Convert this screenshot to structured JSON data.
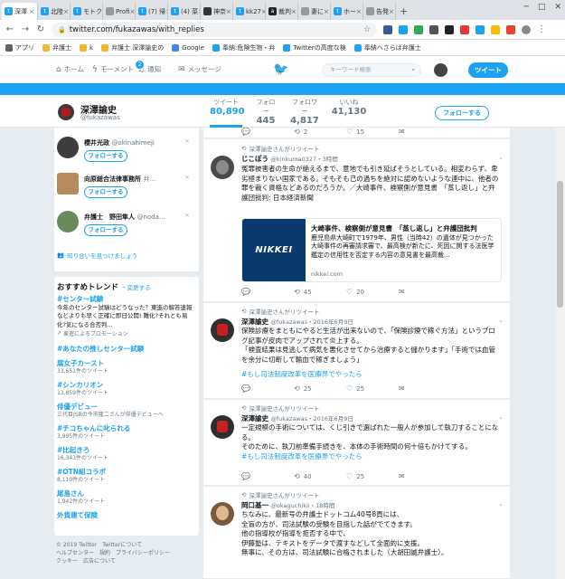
{
  "browser": {
    "tabs": [
      {
        "label": "深澤",
        "icon": "twitter-icon",
        "active": true
      },
      {
        "label": "北陸",
        "icon": "twitter-icon"
      },
      {
        "label": "モトク",
        "icon": "twitter-icon"
      },
      {
        "label": "Profi",
        "icon": "page-icon"
      },
      {
        "label": "(7) 帰",
        "icon": "twitter-icon"
      },
      {
        "label": "(4) 菜",
        "icon": "twitter-icon"
      },
      {
        "label": "神奈",
        "icon": "site-icon"
      },
      {
        "label": "kk27",
        "icon": "twitter-icon"
      },
      {
        "label": "裁判",
        "icon": "amazon-icon"
      },
      {
        "label": "妻に",
        "icon": "page-icon"
      },
      {
        "label": "ホー",
        "icon": "twitter-icon"
      },
      {
        "label": "告発",
        "icon": "page-icon"
      }
    ],
    "url": "twitter.com/fukazawas/with_replies",
    "bookmarks": [
      {
        "label": "アプリ",
        "icon": "apps-icon"
      },
      {
        "label": "弁護士",
        "icon": "folder-icon"
      },
      {
        "label": "k",
        "icon": "folder-icon"
      },
      {
        "label": "弁護士 深澤諭史の",
        "icon": "folder-icon"
      },
      {
        "label": "Google",
        "icon": "google-icon"
      },
      {
        "label": "奉納:危険生物・弁",
        "icon": "twitter-icon"
      },
      {
        "label": "Twitterの高度な検",
        "icon": "twitter-icon"
      },
      {
        "label": "奉納へさらば弁護士",
        "icon": "twitter-icon"
      }
    ]
  },
  "twitter_nav": {
    "home": "ホーム",
    "moments": "モーメント",
    "notifications": "通知",
    "notif_count": "2",
    "messages": "メッセージ",
    "search_placeholder": "キーワード検索",
    "tweet_button": "ツイート"
  },
  "profile": {
    "name": "深澤諭史",
    "handle": "@fukazawas",
    "stats": [
      {
        "label": "ツイート",
        "value": "80,890"
      },
      {
        "label": "フォロー",
        "value": "445"
      },
      {
        "label": "フォロワー",
        "value": "4,817"
      },
      {
        "label": "いいね",
        "value": "41,130"
      }
    ],
    "follow_button": "フォローする"
  },
  "who_to_follow": {
    "users": [
      {
        "name": "櫻井光政",
        "handle": "@okinahimeji",
        "follow": "フォローする"
      },
      {
        "name": "向原総合法律事務所",
        "handle": "弁...",
        "follow": "フォローする"
      },
      {
        "name": "弁護士　野田隼人",
        "handle": "@noda...",
        "follow": "フォローする"
      }
    ],
    "find_friends": "知り合いを見つけましょう"
  },
  "trends": {
    "title": "おすすめトレンド",
    "change": "・変更する",
    "items": [
      {
        "name": "#センター試験",
        "desc": "今年のセンター試験はどうなった？東進の解答速報などよりも早く正確に即日公開! 難化?それとも易化?気になる合否判...",
        "promoted": "東進によるプロモーション"
      },
      {
        "name": "#あなたの推しセンター試験",
        "count": ""
      },
      {
        "name": "腐女子カースト",
        "count": "33,651件のツイート"
      },
      {
        "name": "#シンカリオン",
        "count": "13,859件のツイート"
      },
      {
        "name": "俳優デビュー",
        "count": "三代目JSBの今市隆二さんが俳優デビューへ"
      },
      {
        "name": "#チコちゃんに叱られる",
        "count": "3,995件のツイート"
      },
      {
        "name": "#比起きろ",
        "count": "16,343件のツイート"
      },
      {
        "name": "#OTN組コラボ",
        "count": "8,110件のツイート"
      },
      {
        "name": "尾島さん",
        "count": "1,942件のツイート"
      },
      {
        "name": "外貨建て保険",
        "count": ""
      }
    ]
  },
  "footer": {
    "lines": [
      "© 2019 Twitter　Twitterについて",
      "ヘルプセンター　規約　プライバシーポリシー",
      "クッキー　広告について"
    ]
  },
  "tweets": {
    "top_actions": {
      "replies": "",
      "retweets": "2",
      "likes": "15"
    },
    "t1": {
      "context": "深澤諭史さんがリツイート",
      "name": "じこぽう",
      "handle": "@kinkuma0327",
      "time": "・3時間",
      "text": "冤罪被害者の生命が絶えるまで、意地でも引き延ばそうとしている。相変わらず、卑劣極まりない国家である。そもそも己の過ちを絶対に認めないような連中に、他者の罪を裁く資格などあるのだろうか。／大崎事件、検察側が意見書　「蒸し返し」と弁護団批判: 日本経済新聞",
      "card_image": "NIKKEI",
      "card_title": "大崎事件、検察側が意見書　「蒸し返し」と弁護団批判",
      "card_desc": "鹿児島県大崎町で1979年、男性（当時42）の遺体が見つかった大崎事件の再審請求審で、最高検が新たに、死因に関する法医学鑑定の信用性を否定する内容の意見書を最高裁...",
      "card_url": "nikkei.com",
      "replies": "",
      "retweets": "45",
      "likes": "20"
    },
    "t2": {
      "context": "深澤諭史さんがリツイート",
      "name": "深澤諭史",
      "handle": "@fukazawas",
      "time": "・2016年6月9日",
      "text1": "保険診療をまともにやると生活が出来ないので、「保険診療で稼ぐ方法」というブログ記事が皮肉でアップされて炎上する。",
      "text2": "「検査結果は見逃して病気を悪化させてから治療すると儲かります」「手術では血管を余分に切断して輸血で稼ぎましょう」",
      "hashtag": "#もし司法制度改革を医療界でやったら",
      "replies": "",
      "retweets": "25",
      "likes": "25"
    },
    "t3": {
      "context": "深澤諭史さんがリツイート",
      "name": "深澤諭史",
      "handle": "@fukazawas",
      "time": "・2016年6月9日",
      "text1": "一定規模の手術については、くじ引きで選ばれた一般人が参加して執刀することになる。",
      "text2": "そのために、執刀前準備手続きを、本体の手術時間の何十倍もかけてする。",
      "hashtag": "#もし司法制度改革を医療界でやったら",
      "replies": "",
      "retweets": "40",
      "likes": "25"
    },
    "t4": {
      "context": "深澤諭史さんがリツイート",
      "name": "岡口基一",
      "handle": "@okaguchikii",
      "time": "・18時間",
      "lines": [
        "ちなみに、最新号の弁護士ドットコム40号8頁には、",
        "全盲の方が、司法試験の受験を目指した話がでてきます。",
        "他の指導校が指導を拒否する中で、",
        "伊藤塾は、テキストをデータで渡すなどして全面的に支援。",
        "無事に、その方は、司法試験に合格されました（大胡田誠弁護士）。"
      ]
    }
  },
  "colors": {
    "accent": "#1da1f2",
    "background": "#e6ecf0",
    "text": "#14171a",
    "muted": "#657786"
  }
}
